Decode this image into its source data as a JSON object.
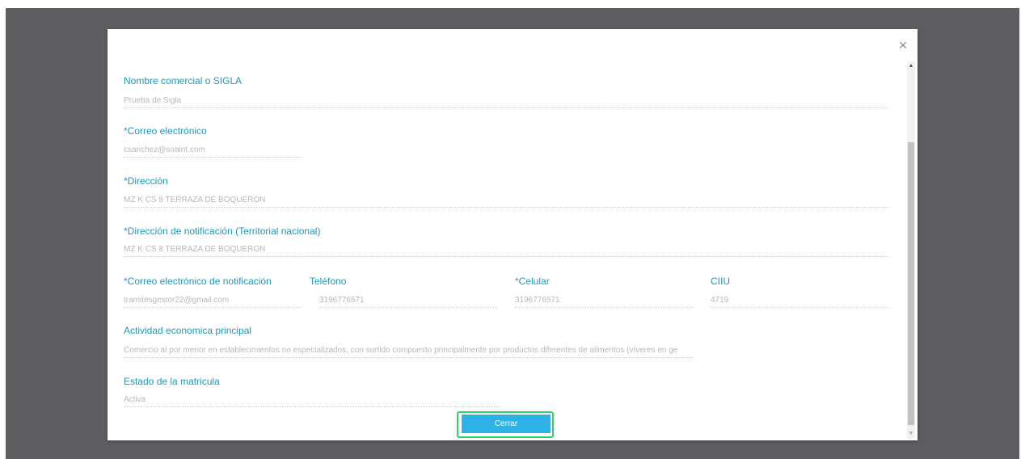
{
  "modal": {
    "close_icon": "close-icon",
    "close_glyph": "×",
    "fields": {
      "nombre_comercial": {
        "label": "Nombre comercial o SIGLA",
        "value": "Prueba de Sigla"
      },
      "correo": {
        "label": "*Correo electrónico",
        "value": "csanchez@soaint.com"
      },
      "direccion": {
        "label": "*Dirección",
        "value": "MZ K CS 8 TERRAZA DE BOQUERON"
      },
      "direccion_notificacion": {
        "label": "*Dirección de notificación (Territorial nacional)",
        "value": "MZ K CS 8 TERRAZA DE BOQUERON"
      },
      "correo_notificacion": {
        "label": "*Correo electrónico de notificación",
        "value": "tramitesgestor22@gmail.com"
      },
      "telefono": {
        "label": "Teléfono",
        "value": "3196776571"
      },
      "celular": {
        "label": "*Celular",
        "value": "3196776571"
      },
      "ciiu": {
        "label": "CIIU",
        "value": "4719"
      },
      "actividad": {
        "label": "Actividad economica principal",
        "value": "Comercio al por menor en establecimientos no especializados, con surtido compuesto principalmente por productos diferentes de alimentos (víveres en ge"
      },
      "estado": {
        "label": "Estado de la matricula",
        "value": "Activa"
      }
    },
    "button": {
      "label": "Cerrar"
    }
  },
  "colors": {
    "label": "#1f99b9",
    "button": "#2fb2e6",
    "highlight": "#2fd36b",
    "backdrop": "#5d5d61"
  }
}
